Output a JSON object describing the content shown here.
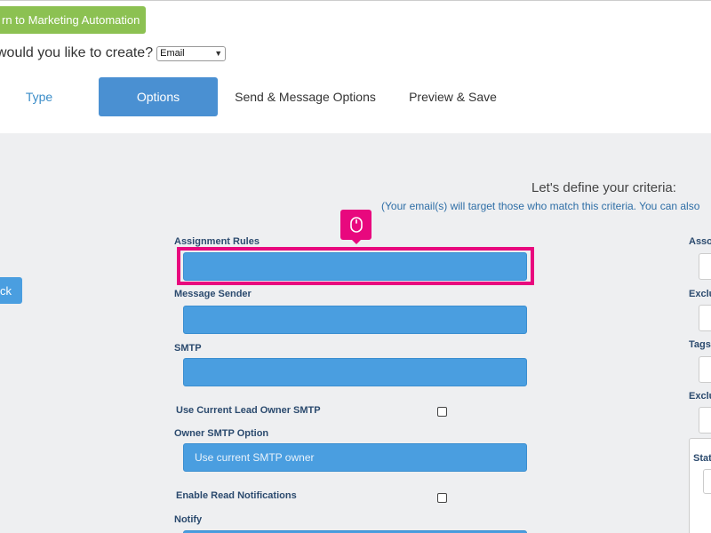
{
  "header": {
    "return_button": "rn to Marketing Automation",
    "create_question": "would you like to create?",
    "create_select_value": "Email"
  },
  "tabs": [
    {
      "label": "Type"
    },
    {
      "label": "Options"
    },
    {
      "label": "Send & Message Options"
    },
    {
      "label": "Preview & Save"
    }
  ],
  "back_button": "ck",
  "criteria": {
    "title": "Let's define your criteria:",
    "subtitle": "(Your email(s) will target those who match this criteria. You can also"
  },
  "form": {
    "assignment_rules_label": "Assignment Rules",
    "message_sender_label": "Message Sender",
    "smtp_label": "SMTP",
    "use_current_smtp_label": "Use Current Lead Owner SMTP",
    "owner_smtp_label": "Owner SMTP Option",
    "owner_smtp_placeholder": "Use current SMTP owner",
    "enable_read_label": "Enable Read Notifications",
    "notify_label": "Notify"
  },
  "right_column": {
    "assoc_label": "Asso",
    "exclu_label_1": "Exclu",
    "tags_label": "Tags",
    "exclu_label_2": "Exclu",
    "stat_label": "Stat"
  },
  "colors": {
    "accent_blue": "#4a9ee0",
    "tab_active": "#4a90d2",
    "return_green": "#8cc152",
    "highlight_pink": "#e8087e",
    "main_bg": "#eeeff1"
  },
  "icons": {
    "cursor_badge": "mouse-icon",
    "select_chevron": "chevron-down-icon"
  }
}
